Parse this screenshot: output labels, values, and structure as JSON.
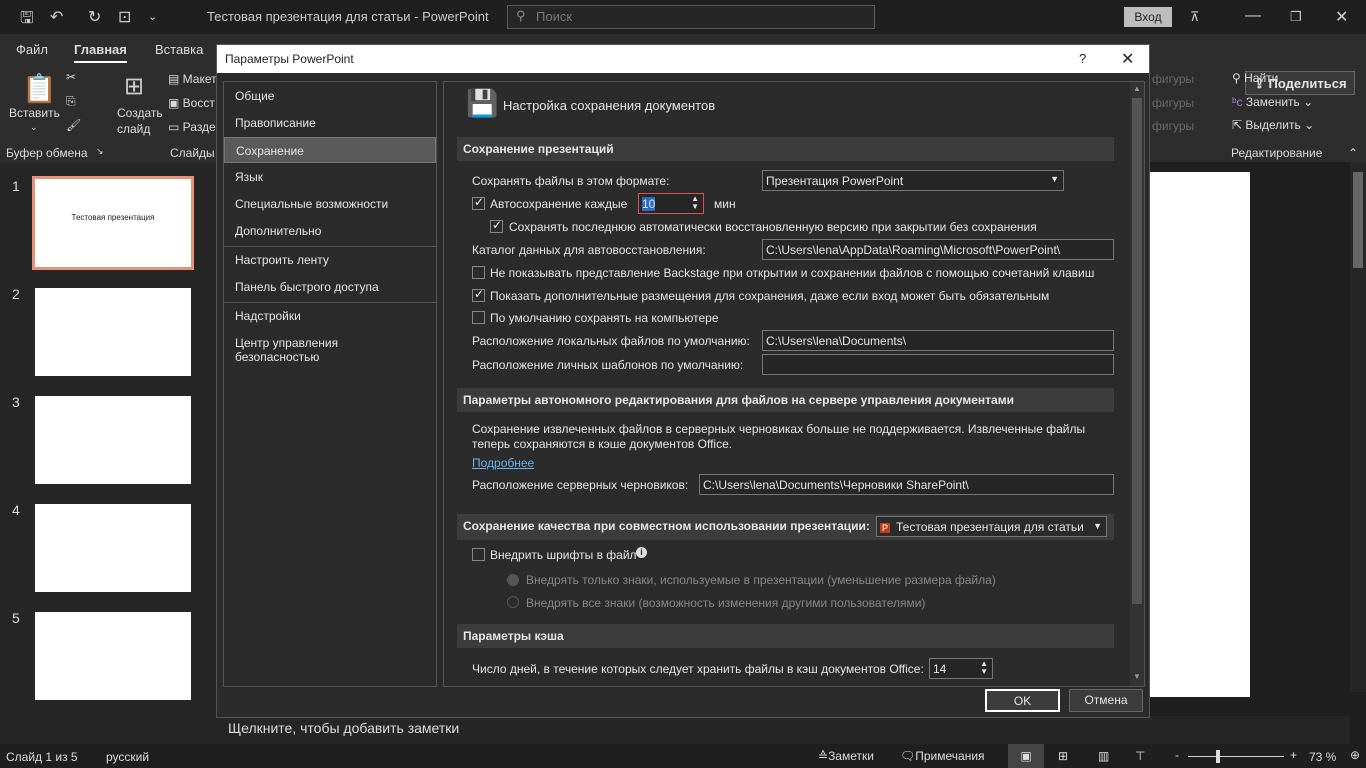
{
  "titlebar": {
    "doc_title": "Тестовая презентация для статьи  -  PowerPoint",
    "search_placeholder": "Поиск",
    "login": "Вход"
  },
  "ribbon": {
    "tabs": [
      "Файл",
      "Главная",
      "Вставка"
    ],
    "paste": "Вставить",
    "clipboard_group": "Буфер обмена",
    "new_slide_1": "Создать",
    "new_slide_2": "слайд",
    "layout": "Макет",
    "reset": "Восст",
    "section": "Разде",
    "slides_group": "Слайды",
    "shapes": [
      "фигуры",
      "фигуры",
      "фигуры"
    ],
    "find": "Найти",
    "replace": "Заменить",
    "select": "Выделить",
    "editing_group": "Редактирование",
    "share": "Поделиться"
  },
  "thumbnails": {
    "numbers": [
      "1",
      "2",
      "3",
      "4",
      "5"
    ],
    "slide1_title": "Тестовая презентация"
  },
  "notes_placeholder": "Щелкните, чтобы добавить заметки",
  "status": {
    "slide": "Слайд 1 из 5",
    "language": "русский",
    "notes": "Заметки",
    "comments": "Примечания",
    "zoom": "73 %",
    "zoom_percent": 73
  },
  "dialog": {
    "title": "Параметры PowerPoint",
    "help": "?",
    "nav": [
      "Общие",
      "Правописание",
      "Сохранение",
      "Язык",
      "Специальные возможности",
      "Дополнительно",
      "Настроить ленту",
      "Панель быстрого доступа",
      "Надстройки",
      "Центр управления безопасностью"
    ],
    "selected_nav": "Сохранение",
    "heading": "Настройка сохранения документов",
    "sec_save": "Сохранение презентаций",
    "format_label": "Сохранять файлы в этом формате:",
    "format_value": "Презентация PowerPoint",
    "autosave_label": "Автосохранение каждые",
    "autosave_value": "10",
    "autosave_unit": "мин",
    "keep_last": "Сохранять последнюю автоматически восстановленную версию при закрытии без сохранения",
    "autorecover_label": "Каталог данных для автовосстановления:",
    "autorecover_value": "C:\\Users\\lena\\AppData\\Roaming\\Microsoft\\PowerPoint\\",
    "no_backstage": "Не показывать представление Backstage при открытии и сохранении файлов с помощью сочетаний клавиш",
    "show_places": "Показать дополнительные размещения для сохранения, даже если вход может быть обязательным",
    "save_local": "По умолчанию сохранять на компьютере",
    "local_label": "Расположение локальных файлов по умолчанию:",
    "local_value": "C:\\Users\\lena\\Documents\\",
    "templates_label": "Расположение личных шаблонов по умолчанию:",
    "templates_value": "",
    "sec_offline": "Параметры автономного редактирования для файлов на сервере управления документами",
    "offline_text_1": "Сохранение извлеченных файлов в серверных черновиках больше не поддерживается. Извлеченные файлы",
    "offline_text_2": "теперь сохраняются в кэше документов Office.",
    "more_link": "Подробнее",
    "drafts_label": "Расположение серверных черновиков:",
    "drafts_value": "C:\\Users\\lena\\Documents\\Черновики SharePoint\\",
    "sec_quality": "Сохранение качества при совместном использовании презентации:",
    "quality_value": "Тестовая презентация для статьи",
    "embed_fonts": "Внедрить шрифты в файл",
    "embed_used": "Внедрять только знаки, используемые в презентации (уменьшение размера файла)",
    "embed_all": "Внедрять все знаки (возможность изменения другими пользователями)",
    "sec_cache": "Параметры кэша",
    "cache_days_label": "Число дней, в течение которых следует хранить файлы в кэш документов Office:",
    "cache_days_value": "14",
    "ok": "OK",
    "cancel": "Отмена"
  }
}
